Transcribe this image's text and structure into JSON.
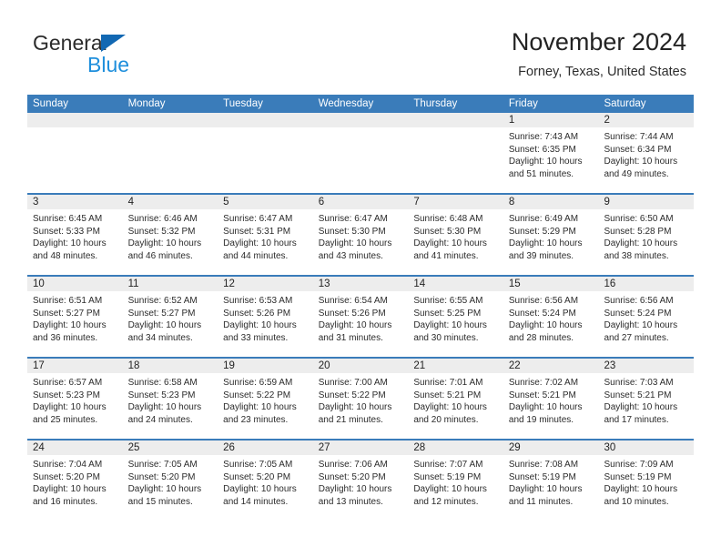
{
  "brand": {
    "name_part1": "General",
    "name_part2": "Blue",
    "triangle_color": "#1268b3",
    "blue_text_color": "#1f8fdc"
  },
  "header": {
    "title": "November 2024",
    "subtitle": "Forney, Texas, United States",
    "accent_color": "#3a7cba",
    "daynum_band_color": "#ededed"
  },
  "weekdays": [
    "Sunday",
    "Monday",
    "Tuesday",
    "Wednesday",
    "Thursday",
    "Friday",
    "Saturday"
  ],
  "labels": {
    "sunrise": "Sunrise:",
    "sunset": "Sunset:",
    "daylight": "Daylight:"
  },
  "weeks": [
    [
      {
        "day": "",
        "sunrise": "",
        "sunset": "",
        "daylight1": "",
        "daylight2": ""
      },
      {
        "day": "",
        "sunrise": "",
        "sunset": "",
        "daylight1": "",
        "daylight2": ""
      },
      {
        "day": "",
        "sunrise": "",
        "sunset": "",
        "daylight1": "",
        "daylight2": ""
      },
      {
        "day": "",
        "sunrise": "",
        "sunset": "",
        "daylight1": "",
        "daylight2": ""
      },
      {
        "day": "",
        "sunrise": "",
        "sunset": "",
        "daylight1": "",
        "daylight2": ""
      },
      {
        "day": "1",
        "sunrise": "Sunrise: 7:43 AM",
        "sunset": "Sunset: 6:35 PM",
        "daylight1": "Daylight: 10 hours",
        "daylight2": "and 51 minutes."
      },
      {
        "day": "2",
        "sunrise": "Sunrise: 7:44 AM",
        "sunset": "Sunset: 6:34 PM",
        "daylight1": "Daylight: 10 hours",
        "daylight2": "and 49 minutes."
      }
    ],
    [
      {
        "day": "3",
        "sunrise": "Sunrise: 6:45 AM",
        "sunset": "Sunset: 5:33 PM",
        "daylight1": "Daylight: 10 hours",
        "daylight2": "and 48 minutes."
      },
      {
        "day": "4",
        "sunrise": "Sunrise: 6:46 AM",
        "sunset": "Sunset: 5:32 PM",
        "daylight1": "Daylight: 10 hours",
        "daylight2": "and 46 minutes."
      },
      {
        "day": "5",
        "sunrise": "Sunrise: 6:47 AM",
        "sunset": "Sunset: 5:31 PM",
        "daylight1": "Daylight: 10 hours",
        "daylight2": "and 44 minutes."
      },
      {
        "day": "6",
        "sunrise": "Sunrise: 6:47 AM",
        "sunset": "Sunset: 5:30 PM",
        "daylight1": "Daylight: 10 hours",
        "daylight2": "and 43 minutes."
      },
      {
        "day": "7",
        "sunrise": "Sunrise: 6:48 AM",
        "sunset": "Sunset: 5:30 PM",
        "daylight1": "Daylight: 10 hours",
        "daylight2": "and 41 minutes."
      },
      {
        "day": "8",
        "sunrise": "Sunrise: 6:49 AM",
        "sunset": "Sunset: 5:29 PM",
        "daylight1": "Daylight: 10 hours",
        "daylight2": "and 39 minutes."
      },
      {
        "day": "9",
        "sunrise": "Sunrise: 6:50 AM",
        "sunset": "Sunset: 5:28 PM",
        "daylight1": "Daylight: 10 hours",
        "daylight2": "and 38 minutes."
      }
    ],
    [
      {
        "day": "10",
        "sunrise": "Sunrise: 6:51 AM",
        "sunset": "Sunset: 5:27 PM",
        "daylight1": "Daylight: 10 hours",
        "daylight2": "and 36 minutes."
      },
      {
        "day": "11",
        "sunrise": "Sunrise: 6:52 AM",
        "sunset": "Sunset: 5:27 PM",
        "daylight1": "Daylight: 10 hours",
        "daylight2": "and 34 minutes."
      },
      {
        "day": "12",
        "sunrise": "Sunrise: 6:53 AM",
        "sunset": "Sunset: 5:26 PM",
        "daylight1": "Daylight: 10 hours",
        "daylight2": "and 33 minutes."
      },
      {
        "day": "13",
        "sunrise": "Sunrise: 6:54 AM",
        "sunset": "Sunset: 5:26 PM",
        "daylight1": "Daylight: 10 hours",
        "daylight2": "and 31 minutes."
      },
      {
        "day": "14",
        "sunrise": "Sunrise: 6:55 AM",
        "sunset": "Sunset: 5:25 PM",
        "daylight1": "Daylight: 10 hours",
        "daylight2": "and 30 minutes."
      },
      {
        "day": "15",
        "sunrise": "Sunrise: 6:56 AM",
        "sunset": "Sunset: 5:24 PM",
        "daylight1": "Daylight: 10 hours",
        "daylight2": "and 28 minutes."
      },
      {
        "day": "16",
        "sunrise": "Sunrise: 6:56 AM",
        "sunset": "Sunset: 5:24 PM",
        "daylight1": "Daylight: 10 hours",
        "daylight2": "and 27 minutes."
      }
    ],
    [
      {
        "day": "17",
        "sunrise": "Sunrise: 6:57 AM",
        "sunset": "Sunset: 5:23 PM",
        "daylight1": "Daylight: 10 hours",
        "daylight2": "and 25 minutes."
      },
      {
        "day": "18",
        "sunrise": "Sunrise: 6:58 AM",
        "sunset": "Sunset: 5:23 PM",
        "daylight1": "Daylight: 10 hours",
        "daylight2": "and 24 minutes."
      },
      {
        "day": "19",
        "sunrise": "Sunrise: 6:59 AM",
        "sunset": "Sunset: 5:22 PM",
        "daylight1": "Daylight: 10 hours",
        "daylight2": "and 23 minutes."
      },
      {
        "day": "20",
        "sunrise": "Sunrise: 7:00 AM",
        "sunset": "Sunset: 5:22 PM",
        "daylight1": "Daylight: 10 hours",
        "daylight2": "and 21 minutes."
      },
      {
        "day": "21",
        "sunrise": "Sunrise: 7:01 AM",
        "sunset": "Sunset: 5:21 PM",
        "daylight1": "Daylight: 10 hours",
        "daylight2": "and 20 minutes."
      },
      {
        "day": "22",
        "sunrise": "Sunrise: 7:02 AM",
        "sunset": "Sunset: 5:21 PM",
        "daylight1": "Daylight: 10 hours",
        "daylight2": "and 19 minutes."
      },
      {
        "day": "23",
        "sunrise": "Sunrise: 7:03 AM",
        "sunset": "Sunset: 5:21 PM",
        "daylight1": "Daylight: 10 hours",
        "daylight2": "and 17 minutes."
      }
    ],
    [
      {
        "day": "24",
        "sunrise": "Sunrise: 7:04 AM",
        "sunset": "Sunset: 5:20 PM",
        "daylight1": "Daylight: 10 hours",
        "daylight2": "and 16 minutes."
      },
      {
        "day": "25",
        "sunrise": "Sunrise: 7:05 AM",
        "sunset": "Sunset: 5:20 PM",
        "daylight1": "Daylight: 10 hours",
        "daylight2": "and 15 minutes."
      },
      {
        "day": "26",
        "sunrise": "Sunrise: 7:05 AM",
        "sunset": "Sunset: 5:20 PM",
        "daylight1": "Daylight: 10 hours",
        "daylight2": "and 14 minutes."
      },
      {
        "day": "27",
        "sunrise": "Sunrise: 7:06 AM",
        "sunset": "Sunset: 5:20 PM",
        "daylight1": "Daylight: 10 hours",
        "daylight2": "and 13 minutes."
      },
      {
        "day": "28",
        "sunrise": "Sunrise: 7:07 AM",
        "sunset": "Sunset: 5:19 PM",
        "daylight1": "Daylight: 10 hours",
        "daylight2": "and 12 minutes."
      },
      {
        "day": "29",
        "sunrise": "Sunrise: 7:08 AM",
        "sunset": "Sunset: 5:19 PM",
        "daylight1": "Daylight: 10 hours",
        "daylight2": "and 11 minutes."
      },
      {
        "day": "30",
        "sunrise": "Sunrise: 7:09 AM",
        "sunset": "Sunset: 5:19 PM",
        "daylight1": "Daylight: 10 hours",
        "daylight2": "and 10 minutes."
      }
    ]
  ]
}
